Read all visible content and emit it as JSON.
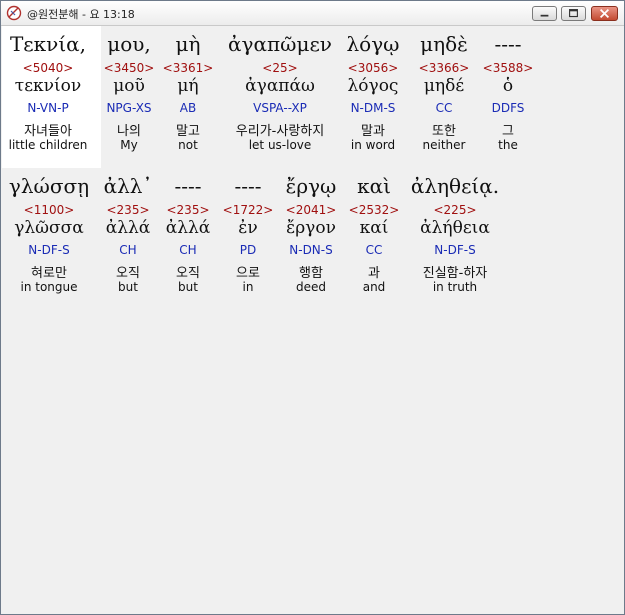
{
  "window": {
    "title": "@원전분해 - 요 13:18"
  },
  "rows": [
    [
      {
        "greek": "Τεκνία,",
        "number": "<5040>",
        "lemma": "τεκνίον",
        "parse": "N-VN-P",
        "korean": "자녀들아",
        "english": "little children"
      },
      {
        "greek": "μου,",
        "number": "<3450>",
        "lemma": "μοῦ",
        "parse": "NPG-XS",
        "korean": "나의",
        "english": "My"
      },
      {
        "greek": "μὴ",
        "number": "<3361>",
        "lemma": "μή",
        "parse": "AB",
        "korean": "말고",
        "english": "not"
      },
      {
        "greek": "ἀγαπῶμεν",
        "number": "<25>",
        "lemma": "ἀγαπάω",
        "parse": "VSPA--XP",
        "korean": "우리가-사랑하지",
        "english": "let us-love"
      },
      {
        "greek": "λόγῳ",
        "number": "<3056>",
        "lemma": "λόγος",
        "parse": "N-DM-S",
        "korean": "말과",
        "english": "in word"
      },
      {
        "greek": "μηδὲ",
        "number": "<3366>",
        "lemma": "μηδέ",
        "parse": "CC",
        "korean": "또한",
        "english": "neither"
      },
      {
        "greek": "----",
        "number": "<3588>",
        "lemma": "ὁ",
        "parse": "DDFS",
        "korean": "그",
        "english": "the"
      }
    ],
    [
      {
        "greek": "γλώσσῃ",
        "number": "<1100>",
        "lemma": "γλῶσσα",
        "parse": "N-DF-S",
        "korean": "혀로만",
        "english": "in tongue"
      },
      {
        "greek": "ἀλλ᾽",
        "number": "<235>",
        "lemma": "ἀλλά",
        "parse": "CH",
        "korean": "오직",
        "english": "but"
      },
      {
        "greek": "----",
        "number": "<235>",
        "lemma": "ἀλλά",
        "parse": "CH",
        "korean": "오직",
        "english": "but"
      },
      {
        "greek": "----",
        "number": "<1722>",
        "lemma": "ἐν",
        "parse": "PD",
        "korean": "으로",
        "english": "in"
      },
      {
        "greek": "ἔργῳ",
        "number": "<2041>",
        "lemma": "ἔργον",
        "parse": "N-DN-S",
        "korean": "행함",
        "english": "deed"
      },
      {
        "greek": "καὶ",
        "number": "<2532>",
        "lemma": "καί",
        "parse": "CC",
        "korean": "과",
        "english": "and"
      },
      {
        "greek": "ἀληθείᾳ.",
        "number": "<225>",
        "lemma": "ἀλήθεια",
        "parse": "N-DF-S",
        "korean": "진실함-하자",
        "english": "in truth"
      }
    ]
  ]
}
